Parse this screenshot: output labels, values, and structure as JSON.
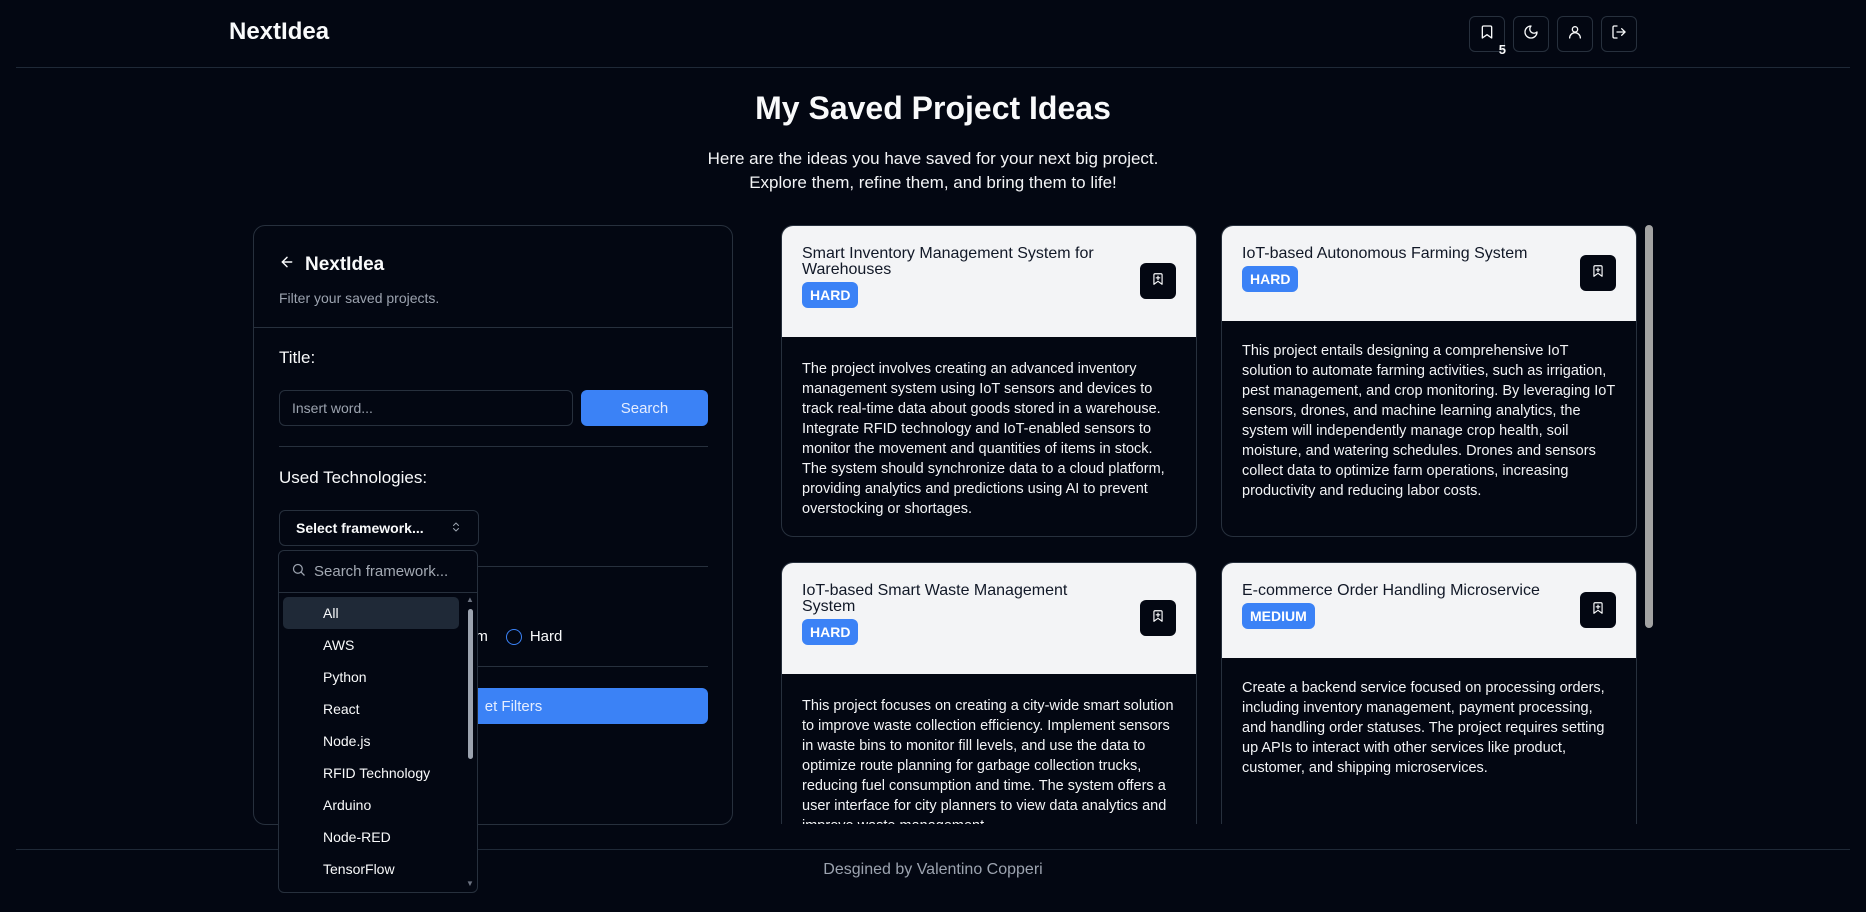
{
  "navbar": {
    "brand": "NextIdea",
    "saved_count": "5",
    "icons": [
      "bookmark-icon",
      "moon-icon",
      "user-icon",
      "logout-icon"
    ]
  },
  "page": {
    "title": "My Saved Project Ideas",
    "subtitle_line1": "Here are the ideas you have saved for your next big project.",
    "subtitle_line2": "Explore them, refine them, and bring them to life!"
  },
  "sidebar": {
    "brand": "NextIdea",
    "subtitle": "Filter your saved projects.",
    "title_label": "Title:",
    "search_placeholder": "Insert word...",
    "search_button": "Search",
    "tech_label": "Used Technologies:",
    "framework_select": "Select framework...",
    "difficulty_medium": "um",
    "difficulty_hard": "Hard",
    "reset_button": "et Filters"
  },
  "dropdown": {
    "search_placeholder": "Search framework...",
    "items": [
      "All",
      "AWS",
      "Python",
      "React",
      "Node.js",
      "RFID Technology",
      "Arduino",
      "Node-RED",
      "TensorFlow"
    ],
    "selected": "All"
  },
  "cards": [
    {
      "title": "Smart Inventory Management System for Warehouses",
      "difficulty": "HARD",
      "description": "The project involves creating an advanced inventory management system using IoT sensors and devices to track real-time data about goods stored in a warehouse. Integrate RFID technology and IoT-enabled sensors to monitor the movement and quantities of items in stock. The system should synchronize data to a cloud platform, providing analytics and predictions using AI to prevent overstocking or shortages."
    },
    {
      "title": "IoT-based Autonomous Farming System",
      "difficulty": "HARD",
      "description": "This project entails designing a comprehensive IoT solution to automate farming activities, such as irrigation, pest management, and crop monitoring. By leveraging IoT sensors, drones, and machine learning analytics, the system will independently manage crop health, soil moisture, and watering schedules. Drones and sensors collect data to optimize farm operations, increasing productivity and reducing labor costs."
    },
    {
      "title": "IoT-based Smart Waste Management System",
      "difficulty": "HARD",
      "description": "This project focuses on creating a city-wide smart solution to improve waste collection efficiency. Implement sensors in waste bins to monitor fill levels, and use the data to optimize route planning for garbage collection trucks, reducing fuel consumption and time. The system offers a user interface for city planners to view data analytics and improve waste management"
    },
    {
      "title": "E-commerce Order Handling Microservice",
      "difficulty": "MEDIUM",
      "description": "Create a backend service focused on processing orders, including inventory management, payment processing, and handling order statuses. The project requires setting up APIs to interact with other services like product, customer, and shipping microservices."
    }
  ],
  "footer": {
    "text": "Desgined by Valentino Copperi"
  }
}
